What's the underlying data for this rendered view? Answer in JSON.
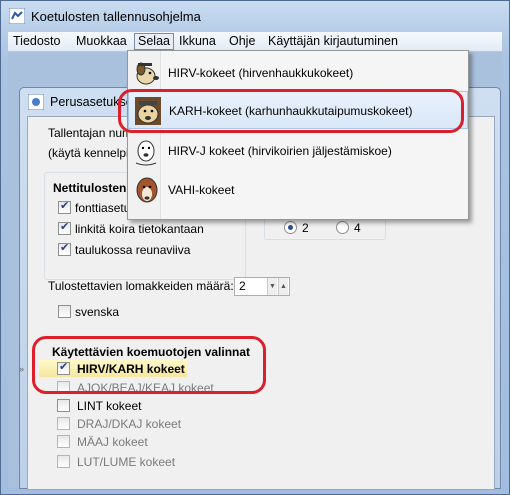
{
  "window": {
    "title": "Koetulosten tallennusohjelma"
  },
  "menubar": {
    "items": [
      "Tiedosto",
      "Muokkaa",
      "Selaa",
      "Ikkuna",
      "Ohje",
      "Käyttäjän kirjautuminen"
    ],
    "active": "Selaa"
  },
  "dialog": {
    "title": "Perusasetukset",
    "tallentajan_label": "Tallentajan numero",
    "kaytä_label": "(käytä kennelpiirin",
    "nettitulosten_title": "Nettitulosten u",
    "options": [
      {
        "label": "fonttiasetus p",
        "checked": true
      },
      {
        "label": "linkitä koira tietokantaan",
        "checked": true
      },
      {
        "label": "taulukossa reunaviiva",
        "checked": true
      }
    ],
    "radio_2": "2",
    "radio_4": "4",
    "radio_selected": "2",
    "lomakkeet_label": "Tulostettavien lomakkeiden määrä:",
    "lomakkeet_value": "2",
    "svenska_label": "svenska",
    "koemuodot_title": "Käytettävien koemuotojen valinnat",
    "koemuodot": [
      {
        "label": "HIRV/KARH kokeet",
        "checked": true,
        "enabled": true
      },
      {
        "label": "AJOK/BEAJ/KEAJ kokeet",
        "checked": false,
        "enabled": false
      },
      {
        "label": "LINT kokeet",
        "checked": false,
        "enabled": true
      },
      {
        "label": "DRAJ/DKAJ kokeet",
        "checked": false,
        "enabled": false
      },
      {
        "label": "MÄAJ kokeet",
        "checked": false,
        "enabled": false
      },
      {
        "label": "LUT/LUME kokeet",
        "checked": false,
        "enabled": false
      }
    ]
  },
  "dropdown": {
    "items": [
      {
        "label": "HIRV-kokeet (hirvenhaukkukokeet)",
        "icon": "dog-icon-hirv"
      },
      {
        "label": "KARH-kokeet (karhunhaukkutaipumuskokeet)",
        "icon": "dog-icon-karh",
        "highlighted": true
      },
      {
        "label": "HIRV-J kokeet (hirvikoirien jäljestämiskoe)",
        "icon": "dog-icon-hirvj"
      },
      {
        "label": "VAHI-kokeet",
        "icon": "dog-icon-vahi"
      }
    ]
  },
  "colors": {
    "annotation": "#dd1f2b",
    "highlight": "#d9e7f8"
  }
}
